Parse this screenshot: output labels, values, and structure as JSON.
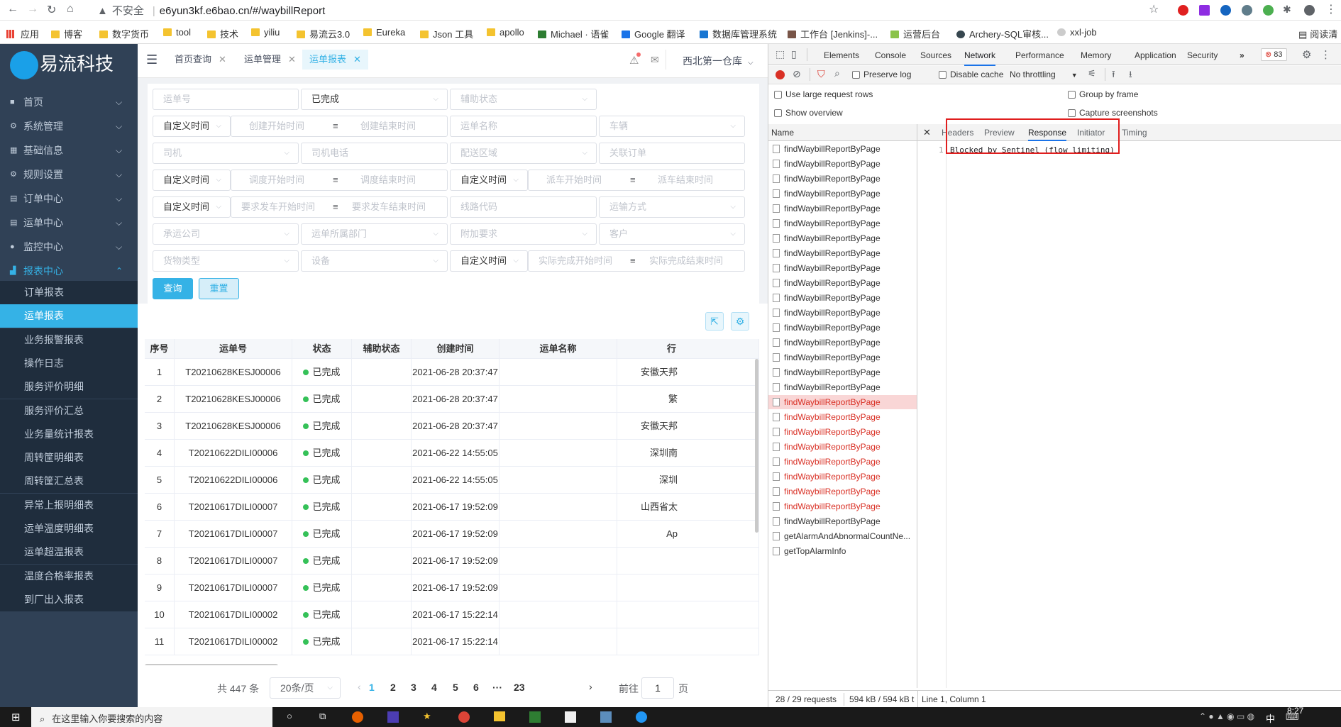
{
  "browser": {
    "insecure": "不安全",
    "url": "e6yun3kf.e6bao.cn/#/waybillReport",
    "bookmarks": [
      "应用",
      "博客",
      "数字货币",
      "tool",
      "技术",
      "yiliu",
      "易流云3.0",
      "Eureka",
      "Json 工具",
      "apollo",
      "Michael · 语雀",
      "Google 翻译",
      "数据库管理系统",
      "工作台 [Jenkins]-...",
      "运营后台",
      "Archery-SQL审核...",
      "xxl-job",
      "阅读清"
    ]
  },
  "app": {
    "logo": "易流科技",
    "menu": [
      {
        "icon": "■",
        "label": "首页",
        "chevron": "⌵"
      },
      {
        "icon": "⚙",
        "label": "系统管理",
        "chevron": "⌵"
      },
      {
        "icon": "▦",
        "label": "基础信息",
        "chevron": "⌵"
      },
      {
        "icon": "⚙",
        "label": "规则设置",
        "chevron": "⌵"
      },
      {
        "icon": "▤",
        "label": "订单中心",
        "chevron": "⌵"
      },
      {
        "icon": "▤",
        "label": "运单中心",
        "chevron": "⌵"
      },
      {
        "icon": "●",
        "label": "监控中心",
        "chevron": "⌵"
      },
      {
        "icon": "▟",
        "label": "报表中心",
        "chevron": "⌃"
      }
    ],
    "submenu": [
      "订单报表",
      "运单报表",
      "业务报警报表",
      "操作日志",
      "服务评价明细",
      "服务评价汇总",
      "业务量统计报表",
      "周转筐明细表",
      "周转筐汇总表",
      "异常上报明细表",
      "运单温度明细表",
      "运单超温报表",
      "温度合格率报表",
      "到厂出入报表"
    ],
    "submenu_active": 1,
    "tabs": [
      {
        "label": "首页查询"
      },
      {
        "label": "运单管理"
      },
      {
        "label": "运单报表"
      }
    ],
    "warehouse": "西北第一仓库",
    "filters": {
      "waybill_no": "运单号",
      "status": "已完成",
      "aux_status": "辅助状态",
      "custom_time": "自定义时间",
      "create_start": "创建开始时间",
      "create_end": "创建结束时间",
      "waybill_name": "运单名称",
      "vehicle": "车辆",
      "driver": "司机",
      "driver_phone": "司机电话",
      "delivery_area": "配送区域",
      "related_order": "关联订单",
      "dispatch_start": "调度开始时间",
      "dispatch_end": "调度结束时间",
      "depart_start": "派车开始时间",
      "depart_end": "派车结束时间",
      "req_depart_start": "要求发车开始时间",
      "req_depart_end": "要求发车结束时间",
      "route_code": "线路代码",
      "transport_mode": "运输方式",
      "carrier": "承运公司",
      "dept": "运单所属部门",
      "extra_req": "附加要求",
      "customer": "客户",
      "goods_type": "货物类型",
      "device": "设备",
      "actual_start": "实际完成开始时间",
      "actual_end": "实际完成结束时间",
      "query": "查询",
      "reset": "重置"
    },
    "table": {
      "headers": [
        "序号",
        "运单号",
        "状态",
        "辅助状态",
        "创建时间",
        "运单名称",
        "行"
      ],
      "rows": [
        [
          "1",
          "T20210628KESJ00006",
          "已完成",
          "",
          "2021-06-28 20:37:47",
          "",
          "安徽天邦"
        ],
        [
          "2",
          "T20210628KESJ00006",
          "已完成",
          "",
          "2021-06-28 20:37:47",
          "",
          "繁"
        ],
        [
          "3",
          "T20210628KESJ00006",
          "已完成",
          "",
          "2021-06-28 20:37:47",
          "",
          "安徽天邦"
        ],
        [
          "4",
          "T20210622DILI00006",
          "已完成",
          "",
          "2021-06-22 14:55:05",
          "",
          "深圳南"
        ],
        [
          "5",
          "T20210622DILI00006",
          "已完成",
          "",
          "2021-06-22 14:55:05",
          "",
          "深圳"
        ],
        [
          "6",
          "T20210617DILI00007",
          "已完成",
          "",
          "2021-06-17 19:52:09",
          "",
          "山西省太"
        ],
        [
          "7",
          "T20210617DILI00007",
          "已完成",
          "",
          "2021-06-17 19:52:09",
          "",
          "Ap"
        ],
        [
          "8",
          "T20210617DILI00007",
          "已完成",
          "",
          "2021-06-17 19:52:09",
          "",
          ""
        ],
        [
          "9",
          "T20210617DILI00007",
          "已完成",
          "",
          "2021-06-17 19:52:09",
          "",
          ""
        ],
        [
          "10",
          "T20210617DILI00002",
          "已完成",
          "",
          "2021-06-17 15:22:14",
          "",
          ""
        ],
        [
          "11",
          "T20210617DILI00002",
          "已完成",
          "",
          "2021-06-17 15:22:14",
          "",
          ""
        ]
      ]
    },
    "pager": {
      "total": "共 447 条",
      "page_size": "20条/页",
      "pages": [
        "1",
        "2",
        "3",
        "4",
        "5",
        "6",
        "···",
        "23"
      ],
      "goto": "前往",
      "goto_value": "1",
      "page_unit": "页"
    }
  },
  "devtools": {
    "tabs": [
      "Elements",
      "Console",
      "Sources",
      "Network",
      "Performance",
      "Memory",
      "Application",
      "Security"
    ],
    "active_tab": "Network",
    "error_count": "83",
    "preserve_log": "Preserve log",
    "disable_cache": "Disable cache",
    "throttling": "No throttling",
    "large_rows": "Use large request rows",
    "group_frame": "Group by frame",
    "show_overview": "Show overview",
    "capture": "Capture screenshots",
    "name_header": "Name",
    "detail_tabs": [
      "Headers",
      "Preview",
      "Response",
      "Initiator",
      "Timing"
    ],
    "requests": [
      {
        "name": "findWaybillReportByPage",
        "state": "ok"
      },
      {
        "name": "findWaybillReportByPage",
        "state": "ok"
      },
      {
        "name": "findWaybillReportByPage",
        "state": "ok"
      },
      {
        "name": "findWaybillReportByPage",
        "state": "ok"
      },
      {
        "name": "findWaybillReportByPage",
        "state": "ok"
      },
      {
        "name": "findWaybillReportByPage",
        "state": "ok"
      },
      {
        "name": "findWaybillReportByPage",
        "state": "ok"
      },
      {
        "name": "findWaybillReportByPage",
        "state": "ok"
      },
      {
        "name": "findWaybillReportByPage",
        "state": "ok"
      },
      {
        "name": "findWaybillReportByPage",
        "state": "ok"
      },
      {
        "name": "findWaybillReportByPage",
        "state": "ok"
      },
      {
        "name": "findWaybillReportByPage",
        "state": "ok"
      },
      {
        "name": "findWaybillReportByPage",
        "state": "ok"
      },
      {
        "name": "findWaybillReportByPage",
        "state": "ok"
      },
      {
        "name": "findWaybillReportByPage",
        "state": "ok"
      },
      {
        "name": "findWaybillReportByPage",
        "state": "ok"
      },
      {
        "name": "findWaybillReportByPage",
        "state": "ok"
      },
      {
        "name": "findWaybillReportByPage",
        "state": "selected-error"
      },
      {
        "name": "findWaybillReportByPage",
        "state": "error"
      },
      {
        "name": "findWaybillReportByPage",
        "state": "error"
      },
      {
        "name": "findWaybillReportByPage",
        "state": "error"
      },
      {
        "name": "findWaybillReportByPage",
        "state": "error"
      },
      {
        "name": "findWaybillReportByPage",
        "state": "error"
      },
      {
        "name": "findWaybillReportByPage",
        "state": "error"
      },
      {
        "name": "findWaybillReportByPage",
        "state": "error"
      },
      {
        "name": "findWaybillReportByPage",
        "state": "ok"
      },
      {
        "name": "getAlarmAndAbnormalCountNe...",
        "state": "ok"
      },
      {
        "name": "getTopAlarmInfo",
        "state": "ok"
      }
    ],
    "response_line_no": "1",
    "response_text": "Blocked by Sentinel (flow limiting)",
    "status_requests": "28 / 29 requests",
    "status_size": "594 kB / 594 kB t",
    "status_pos": "Line 1, Column 1"
  },
  "taskbar": {
    "search": "在这里输入你要搜索的内容",
    "time": "8:27",
    "ime": "中"
  },
  "colors": {
    "sidebar": "#304156",
    "accent": "#35b2e6",
    "success": "#35c158",
    "error": "#d93025"
  }
}
